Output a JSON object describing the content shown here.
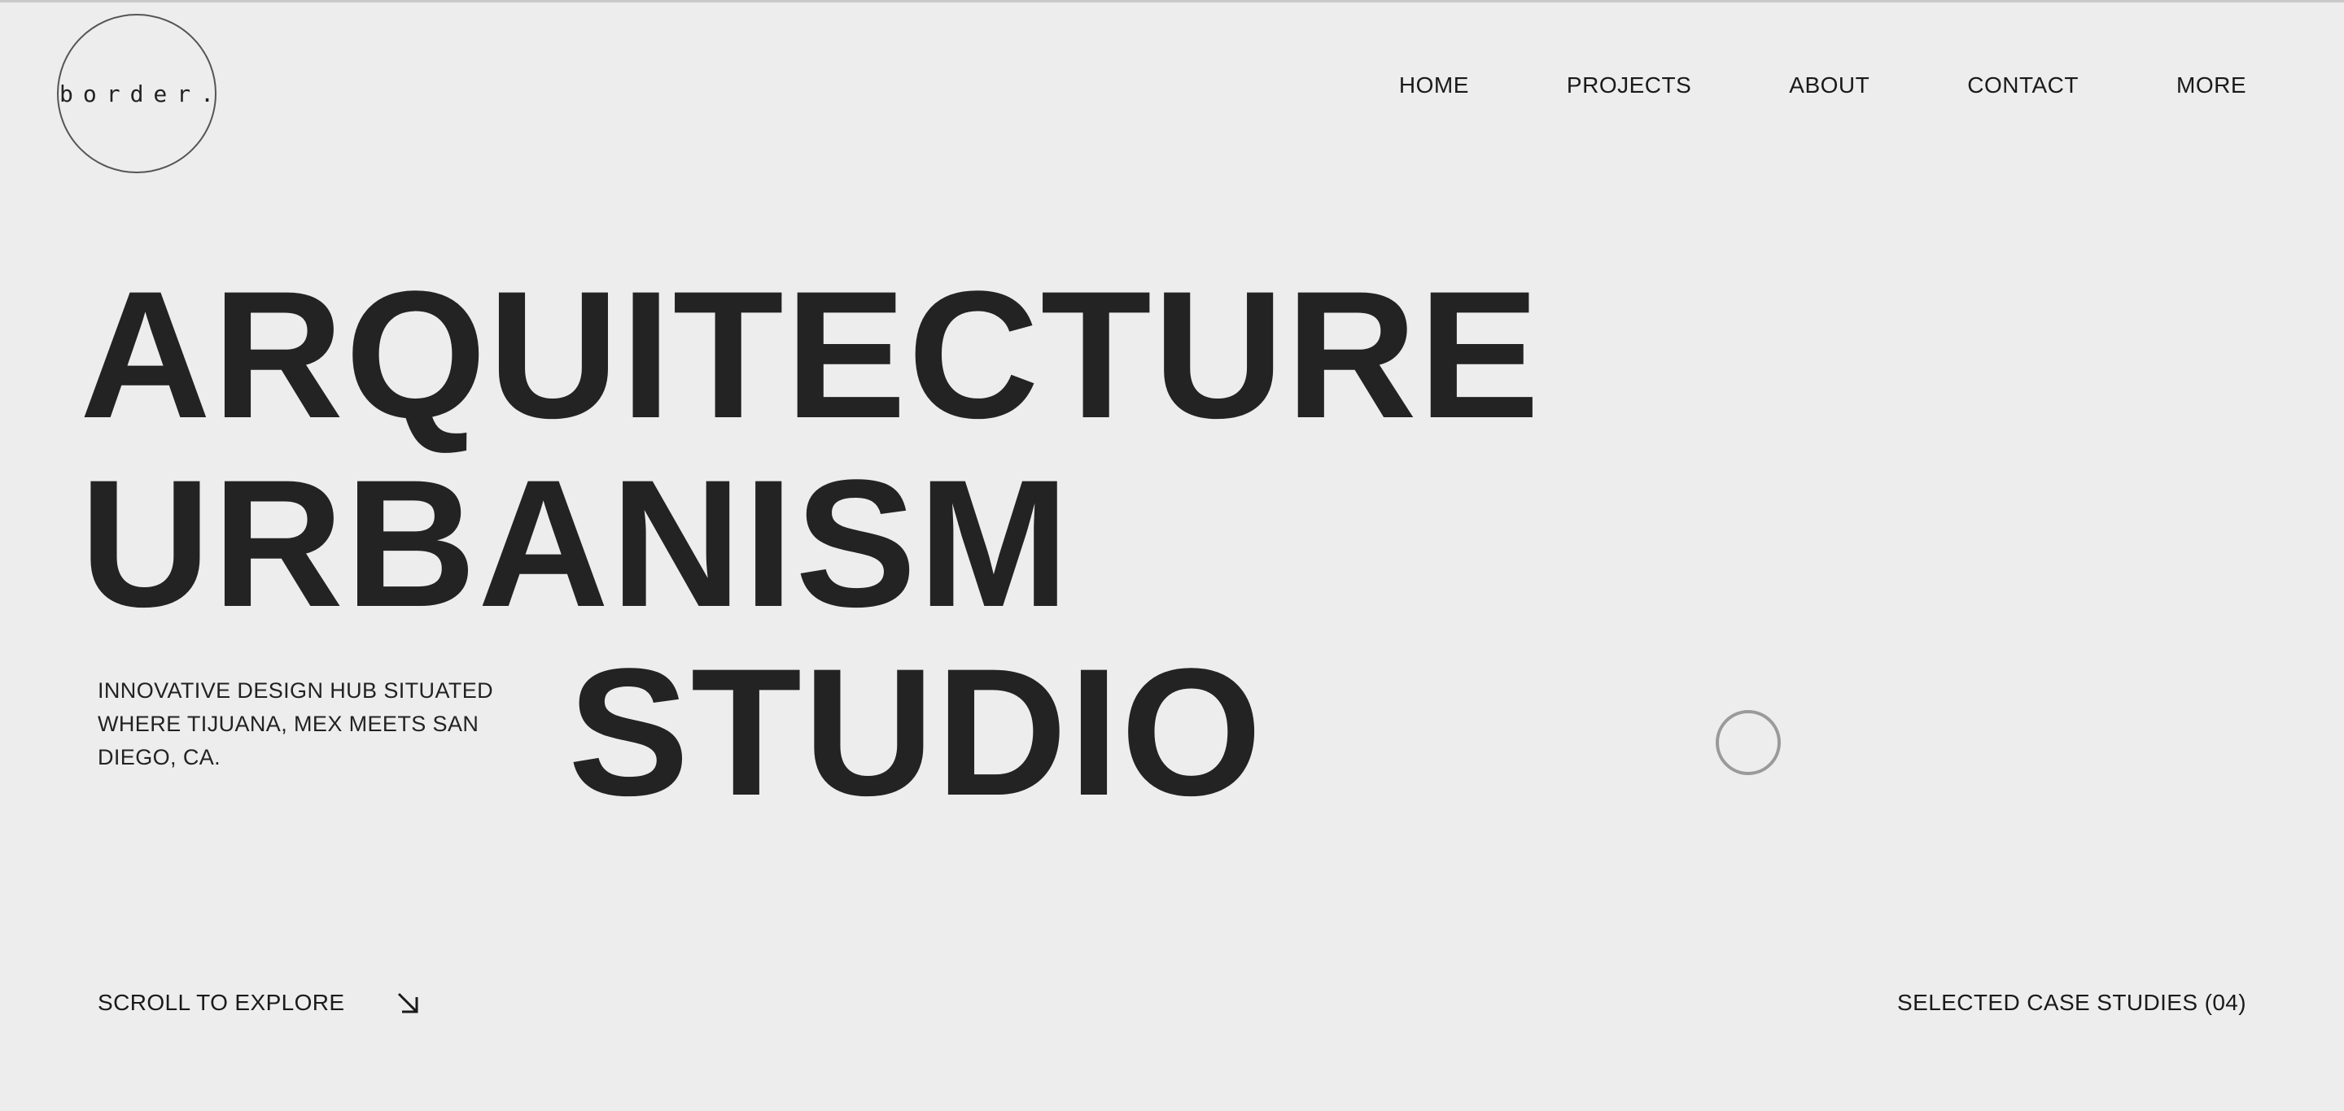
{
  "brand": {
    "logo_text": "border."
  },
  "nav": {
    "items": [
      {
        "label": "HOME"
      },
      {
        "label": "PROJECTS"
      },
      {
        "label": "ABOUT"
      },
      {
        "label": "CONTACT"
      },
      {
        "label": "MORE"
      }
    ]
  },
  "hero": {
    "line1": "ARQUITECTURE",
    "line2": "URBANISM",
    "line3": "STUDIO",
    "tagline": "INNOVATIVE DESIGN HUB SITUATED WHERE TIJUANA, MEX MEETS SAN DIEGO, CA."
  },
  "footer": {
    "scroll_label": "SCROLL TO EXPLORE",
    "scroll_icon": "arrow-down-right-icon",
    "cases_label": "SELECTED CASE STUDIES (04)"
  },
  "colors": {
    "background": "#ededed",
    "text": "#222222",
    "cursor_ring": "#9a9a9a"
  }
}
